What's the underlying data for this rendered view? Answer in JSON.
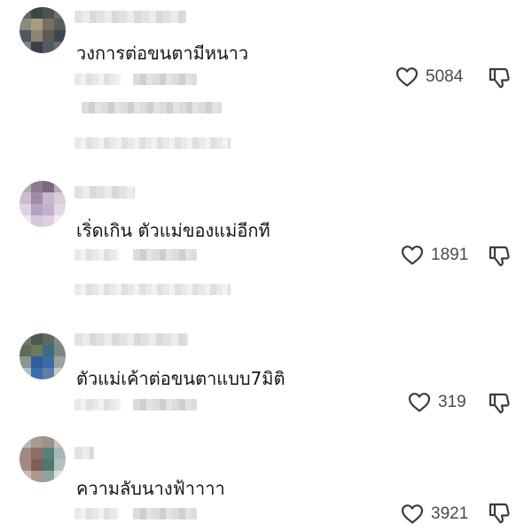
{
  "comments": [
    {
      "text": "วงการต่อขนตามีหนาว",
      "likes": "5084"
    },
    {
      "text": "เริ่ดเกิน ตัวแม่ของแม่อีกที",
      "likes": "1891"
    },
    {
      "text": "ตัวแม่เค้าต่อขนตาแบบ7มิติ",
      "likes": "319"
    },
    {
      "text": "ความลับนางฟ้าาาา",
      "likes": "3921"
    }
  ],
  "icons": {
    "like": "heart-outline-icon",
    "dislike": "thumbs-down-outline-icon"
  },
  "colors": {
    "text": "#161616",
    "count": "#4a4a4a",
    "icon": "#3c3c3c",
    "background": "#ffffff"
  }
}
